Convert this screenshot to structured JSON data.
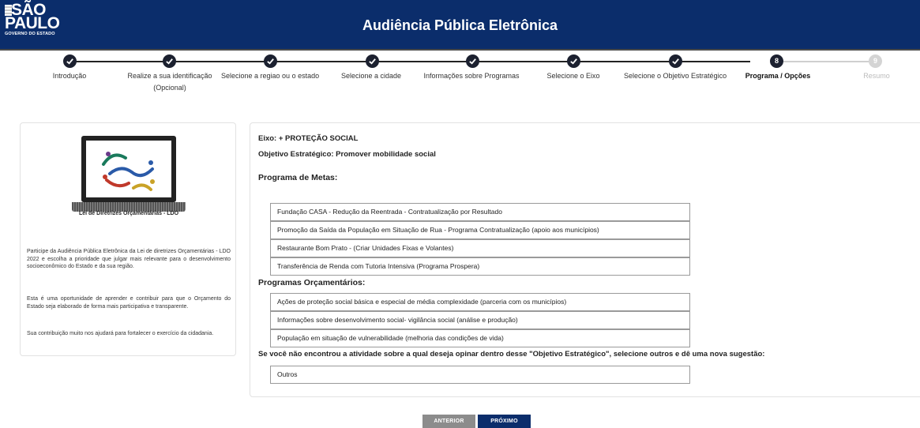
{
  "header": {
    "logo_line1": "SÃO",
    "logo_line2": "PAULO",
    "logo_sub": "GOVERNO DO ESTADO",
    "title": "Audiência Pública Eletrônica"
  },
  "steps": [
    {
      "label": "Introdução",
      "status": "done"
    },
    {
      "label": "Realize a sua identificação",
      "label2": "(Opcional)",
      "status": "done"
    },
    {
      "label": "Selecione a regiao ou o estado",
      "status": "done"
    },
    {
      "label": "Selecione a cidade",
      "status": "done"
    },
    {
      "label": "Informações sobre Programas",
      "status": "done"
    },
    {
      "label": "Selecione o Eixo",
      "status": "done"
    },
    {
      "label": "Selecione o Objetivo Estratégico",
      "status": "done"
    },
    {
      "label": "Programa / Opções",
      "status": "current",
      "number": "8"
    },
    {
      "label": "Resumo",
      "status": "pending",
      "number": "9"
    }
  ],
  "left": {
    "title": "Lei de Diretrizes Orçamentárias - LDO",
    "p1": "Participe da Audiência Pública Eletrônica da Lei de diretrizes Orçamentárias - LDO 2022 e escolha a prioridade que julgar mais relevante para o desenvolvimento socioeconômico do Estado e da sua região.",
    "p2": "Esta é uma oportunidade de aprender e contribuir para que o Orçamento do Estado seja elaborado de forma mais participativa e transparente.",
    "p3": "Sua contribuição muito nos ajudará para fortalecer o exercício da cidadania."
  },
  "main": {
    "eixo": "Eixo: + PROTEÇÃO SOCIAL",
    "objetivo": "Objetivo Estratégico: Promover mobilidade social",
    "metas_title": "Programa de Metas:",
    "metas": [
      "Fundação CASA - Redução da Reentrada - Contratualização por Resultado",
      "Promoção da Saída da População em Situação de Rua - Programa Contratualização (apoio aos municípios)",
      "Restaurante Bom Prato - (Criar Unidades Fixas e Volantes)",
      "Transferência de Renda com Tutoria Intensiva (Programa Prospera)"
    ],
    "orc_title": "Programas Orçamentários:",
    "orc": [
      "Ações de proteção social básica e especial de média complexidade (parceria com os municípios)",
      "Informações sobre desenvolvimento social- vigilância social (análise e produção)",
      "População em situação de vulnerabilidade (melhoria das condições de vida)"
    ],
    "outros_prompt": "Se você não encontrou a atividade sobre a qual deseja opinar dentro desse \"Objetivo Estratégico\", selecione outros e dê uma nova sugestão:",
    "outros": "Outros"
  },
  "buttons": {
    "prev": "ANTERIOR",
    "next": "PRÓXIMO"
  }
}
